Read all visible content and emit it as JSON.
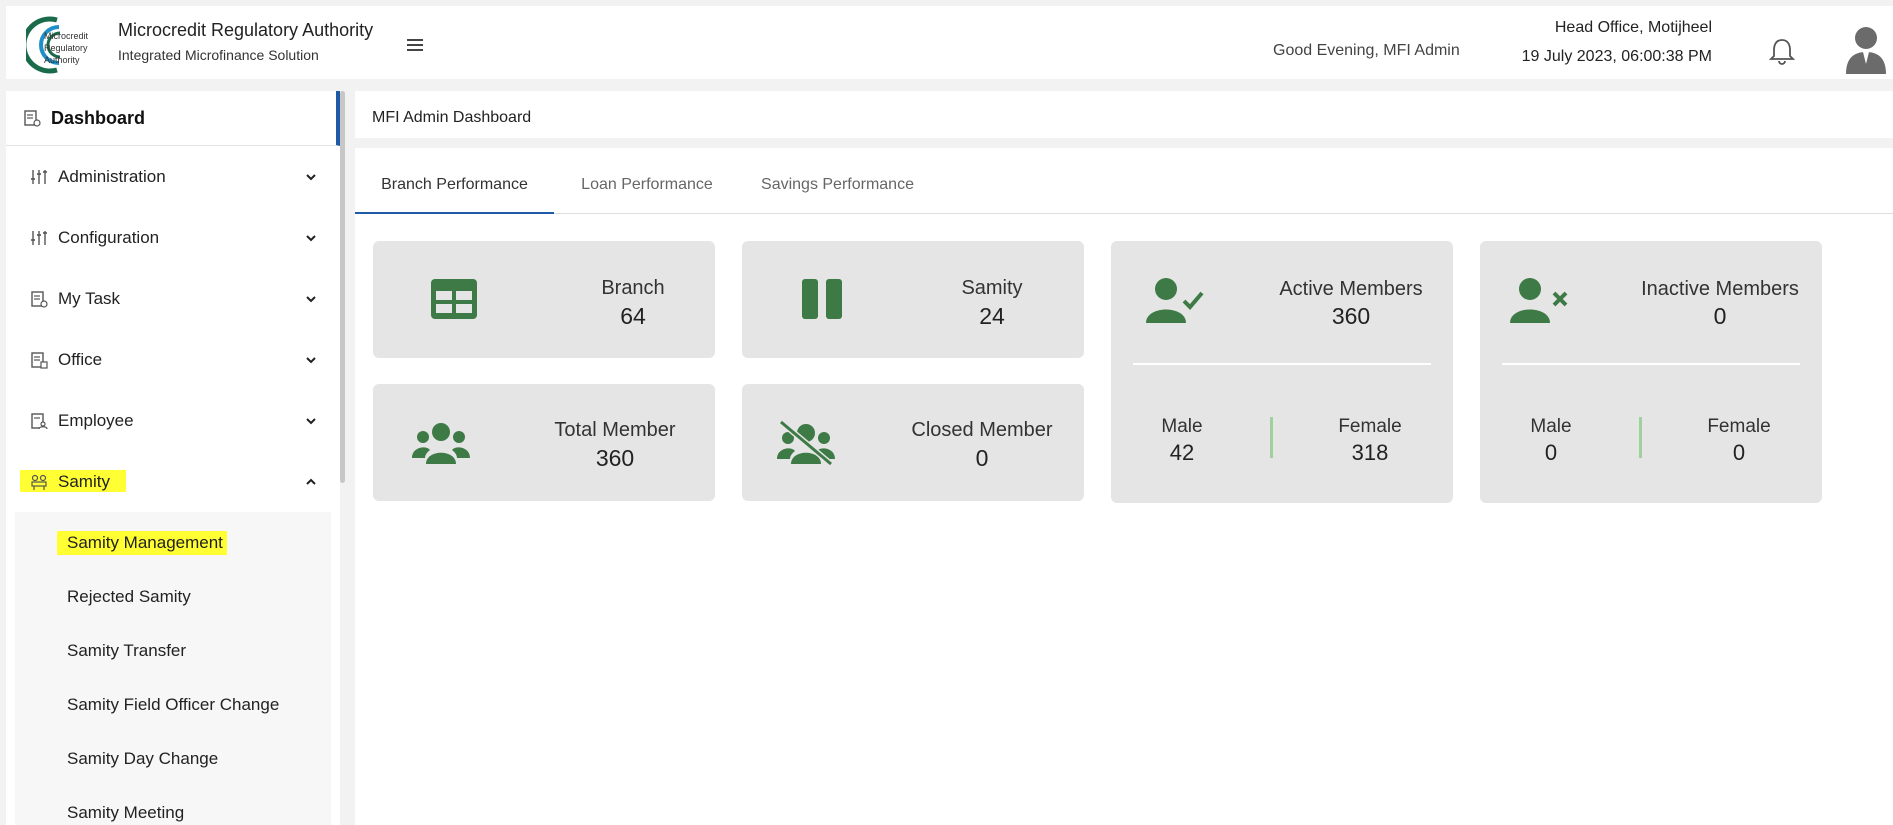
{
  "header": {
    "logo_text": [
      "Microcredit",
      "Regulatory",
      "Authority"
    ],
    "title": "Microcredit Regulatory Authority",
    "subtitle": "Integrated Microfinance Solution",
    "greeting": "Good Evening, MFI Admin",
    "office": "Head Office, Motijheel",
    "datetime": "19 July 2023, 06:00:38 PM",
    "icons": {
      "menu": "hamburger-icon",
      "notifications": "bell-icon",
      "profile": "user-avatar-icon"
    }
  },
  "sidebar": {
    "dashboard": {
      "label": "Dashboard",
      "icon": "dashboard-icon"
    },
    "items": [
      {
        "label": "Administration",
        "icon": "sliders-icon",
        "expanded": false
      },
      {
        "label": "Configuration",
        "icon": "sliders-icon",
        "expanded": false
      },
      {
        "label": "My Task",
        "icon": "task-doc-icon",
        "expanded": false
      },
      {
        "label": "Office",
        "icon": "office-doc-icon",
        "expanded": false
      },
      {
        "label": "Employee",
        "icon": "employee-doc-icon",
        "expanded": false
      },
      {
        "label": "Samity",
        "icon": "group-icon",
        "expanded": true,
        "highlighted": true
      }
    ],
    "samity_submenu": [
      {
        "label": "Samity Management",
        "highlighted": true
      },
      {
        "label": "Rejected Samity"
      },
      {
        "label": "Samity Transfer"
      },
      {
        "label": "Samity Field Officer Change"
      },
      {
        "label": "Samity Day Change"
      },
      {
        "label": "Samity Meeting"
      }
    ]
  },
  "main": {
    "title": "MFI Admin Dashboard",
    "tabs": [
      {
        "label": "Branch Performance",
        "active": true
      },
      {
        "label": "Loan Performance",
        "active": false
      },
      {
        "label": "Savings Performance",
        "active": false
      }
    ],
    "cards": {
      "branch": {
        "label": "Branch",
        "value": "64",
        "icon": "table-icon"
      },
      "samity": {
        "label": "Samity",
        "value": "24",
        "icon": "pause-icon"
      },
      "active_members": {
        "label": "Active Members",
        "value": "360",
        "icon": "user-check-icon",
        "male_label": "Male",
        "male_value": "42",
        "female_label": "Female",
        "female_value": "318"
      },
      "inactive_members": {
        "label": "Inactive Members",
        "value": "0",
        "icon": "user-x-icon",
        "male_label": "Male",
        "male_value": "0",
        "female_label": "Female",
        "female_value": "0"
      },
      "total_member": {
        "label": "Total Member",
        "value": "360",
        "icon": "users-icon"
      },
      "closed_member": {
        "label": "Closed Member",
        "value": "0",
        "icon": "users-slash-icon"
      }
    }
  },
  "colors": {
    "accent": "#1f5aa6",
    "icon_green": "#3e7a46",
    "card_bg": "#e4e5e4",
    "highlight": "#ffff33",
    "separator_green": "#9fd19c"
  }
}
